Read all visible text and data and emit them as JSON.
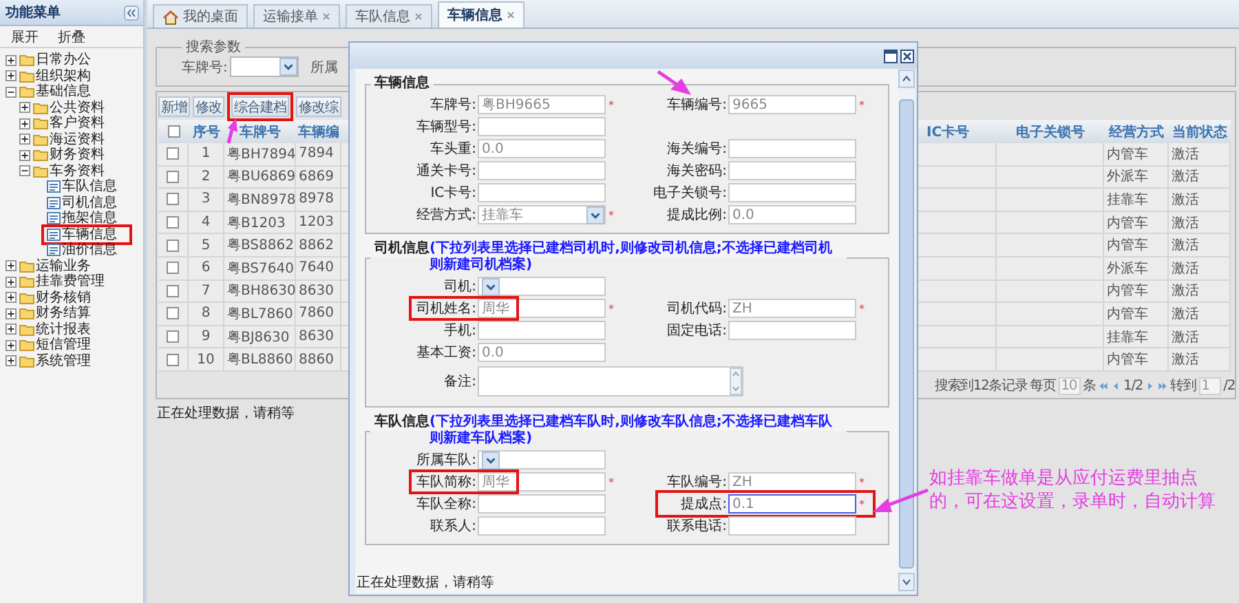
{
  "sidebar": {
    "title": "功能菜单",
    "actions": [
      "展开",
      "折叠"
    ],
    "tree": [
      {
        "label": "日常办公",
        "kind": "folder",
        "expanded": false
      },
      {
        "label": "组织架构",
        "kind": "folder",
        "expanded": false
      },
      {
        "label": "基础信息",
        "kind": "folder",
        "expanded": true,
        "children": [
          {
            "label": "公共资料",
            "kind": "folder",
            "expanded": false
          },
          {
            "label": "客户资料",
            "kind": "folder",
            "expanded": false
          },
          {
            "label": "海运资料",
            "kind": "folder",
            "expanded": false
          },
          {
            "label": "财务资料",
            "kind": "folder",
            "expanded": false
          },
          {
            "label": "车务资料",
            "kind": "folder",
            "expanded": true,
            "children": [
              {
                "label": "车队信息",
                "kind": "leaf"
              },
              {
                "label": "司机信息",
                "kind": "leaf"
              },
              {
                "label": "拖架信息",
                "kind": "leaf"
              },
              {
                "label": "车辆信息",
                "kind": "leaf",
                "annotated": true
              },
              {
                "label": "油价信息",
                "kind": "leaf"
              }
            ]
          }
        ]
      },
      {
        "label": "运输业务",
        "kind": "folder",
        "expanded": false
      },
      {
        "label": "挂靠费管理",
        "kind": "folder",
        "expanded": false
      },
      {
        "label": "财务核销",
        "kind": "folder",
        "expanded": false
      },
      {
        "label": "财务结算",
        "kind": "folder",
        "expanded": false
      },
      {
        "label": "统计报表",
        "kind": "folder",
        "expanded": false
      },
      {
        "label": "短信管理",
        "kind": "folder",
        "expanded": false
      },
      {
        "label": "系统管理",
        "kind": "folder",
        "expanded": false
      }
    ]
  },
  "tabs": [
    {
      "label": "我的桌面",
      "kind": "home",
      "selected": false
    },
    {
      "label": "运输接单",
      "kind": "closable",
      "selected": false
    },
    {
      "label": "车队信息",
      "kind": "closable",
      "selected": false
    },
    {
      "label": "车辆信息",
      "kind": "closable",
      "selected": true
    }
  ],
  "search": {
    "legend": "搜索参数",
    "fields": [
      {
        "label": "车牌号:",
        "kind": "select"
      },
      {
        "label": "所属",
        "kind": "label"
      }
    ]
  },
  "toolbar": [
    {
      "label": "新增"
    },
    {
      "label": "修改"
    },
    {
      "label": "综合建档",
      "annotated": true
    },
    {
      "label": "修改综"
    }
  ],
  "table": {
    "columns": [
      "序号",
      "车牌号",
      "车辆编",
      "IC卡号",
      "电子关锁号",
      "经营方式",
      "当前状态"
    ],
    "header_checked": false,
    "rows": [
      {
        "checked": false,
        "no": "1",
        "plate": "粤BH7894",
        "code": "7894",
        "mode": "内管车",
        "state": "激活"
      },
      {
        "checked": false,
        "no": "2",
        "plate": "粤BU6869",
        "code": "6869",
        "mode": "外派车",
        "state": "激活"
      },
      {
        "checked": false,
        "no": "3",
        "plate": "粤BN8978",
        "code": "8978",
        "mode": "挂靠车",
        "state": "激活"
      },
      {
        "checked": false,
        "no": "4",
        "plate": "粤B1203",
        "code": "1203",
        "mode": "内管车",
        "state": "激活"
      },
      {
        "checked": false,
        "no": "5",
        "plate": "粤BS8862",
        "code": "8862",
        "mode": "内管车",
        "state": "激活"
      },
      {
        "checked": false,
        "no": "6",
        "plate": "粤BS7640",
        "code": "7640",
        "mode": "外派车",
        "state": "激活"
      },
      {
        "checked": false,
        "no": "7",
        "plate": "粤BH8630",
        "code": "8630",
        "mode": "内管车",
        "state": "激活"
      },
      {
        "checked": false,
        "no": "8",
        "plate": "粤BL7860",
        "code": "7860",
        "mode": "内管车",
        "state": "激活"
      },
      {
        "checked": false,
        "no": "9",
        "plate": "粤BJ8630",
        "code": "8630",
        "mode": "挂靠车",
        "state": "激活"
      },
      {
        "checked": false,
        "no": "10",
        "plate": "粤BL8860",
        "code": "8860",
        "mode": "内管车",
        "state": "激活"
      }
    ]
  },
  "pager": {
    "summary": "搜索到12条记录",
    "per_page_label": "每页",
    "per_page": "10",
    "unit": "条",
    "page": "1/2",
    "goto_label": "转到",
    "goto": "1",
    "total": "/2"
  },
  "status_bar": "正在处理数据，请稍等",
  "dialog": {
    "sections": [
      {
        "title": "车辆信息",
        "rows": [
          [
            {
              "label": "车牌号:",
              "kind": "text",
              "value": "粤BH9665",
              "mark": "*"
            },
            {
              "label": "车辆编号:",
              "kind": "text",
              "value": "9665",
              "mark": "*"
            }
          ],
          [
            {
              "label": "车辆型号:",
              "kind": "text"
            },
            null
          ],
          [
            {
              "label": "车头重:",
              "kind": "text",
              "value": "0.0"
            },
            {
              "label": "海关编号:",
              "kind": "text"
            }
          ],
          [
            {
              "label": "通关卡号:",
              "kind": "text"
            },
            {
              "label": "海关密码:",
              "kind": "text"
            }
          ],
          [
            {
              "label": "IC卡号:",
              "kind": "text"
            },
            {
              "label": "电子关锁号:",
              "kind": "text"
            }
          ],
          [
            {
              "label": "经营方式:",
              "kind": "select",
              "value": "挂靠车",
              "mark": "*"
            },
            {
              "label": "提成比例:",
              "kind": "text",
              "value": "0.0"
            }
          ]
        ]
      },
      {
        "title": "司机信息",
        "note": "(下拉列表里选择已建档司机时,则修改司机信息;不选择已建档司机则新建司机档案)",
        "rows": [
          [
            {
              "label": "司机:",
              "kind": "select"
            },
            null
          ],
          [
            {
              "label": "司机姓名:",
              "kind": "text",
              "value": "周华",
              "mark": "*",
              "annotated": true
            },
            {
              "label": "司机代码:",
              "kind": "text",
              "value": "ZH",
              "mark": "*"
            }
          ],
          [
            {
              "label": "手机:",
              "kind": "text"
            },
            {
              "label": "固定电话:",
              "kind": "text"
            }
          ],
          [
            {
              "label": "基本工资:",
              "kind": "text",
              "value": "0.0"
            },
            null
          ],
          [
            {
              "label": "备注:",
              "kind": "textarea"
            },
            null
          ]
        ]
      },
      {
        "title": "车队信息",
        "note": "(下拉列表里选择已建档车队时,则修改车队信息;不选择已建档车队则新建车队档案)",
        "rows": [
          [
            {
              "label": "所属车队:",
              "kind": "select"
            },
            null
          ],
          [
            {
              "label": "车队简称:",
              "kind": "text",
              "value": "周华",
              "mark": "*",
              "annotated": true
            },
            {
              "label": "车队编号:",
              "kind": "text",
              "value": "ZH",
              "mark": "*"
            }
          ],
          [
            {
              "label": "车队全称:",
              "kind": "text"
            },
            {
              "label": "提成点:",
              "kind": "text",
              "value": "0.1",
              "mark": "*",
              "focused": true,
              "annotated": true
            }
          ],
          [
            {
              "label": "联系人:",
              "kind": "text"
            },
            {
              "label": "联系电话:",
              "kind": "text"
            }
          ]
        ]
      }
    ],
    "status": "正在处理数据，请稍等"
  },
  "annotation": {
    "lines": [
      "如挂靠车做单是从应付运费里抽点",
      "的，可在这设置，录单时，自动计算"
    ]
  }
}
